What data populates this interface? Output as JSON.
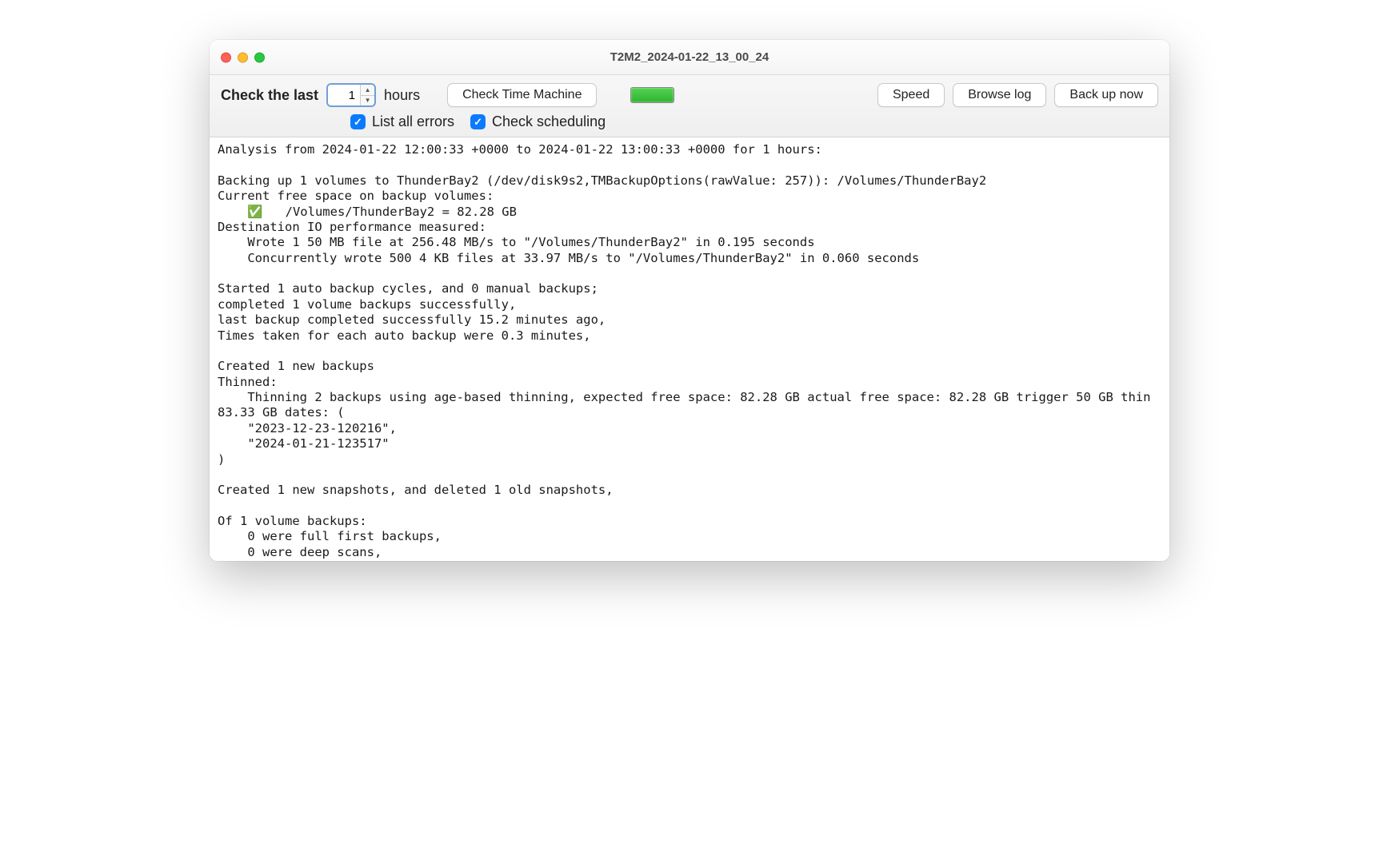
{
  "window": {
    "title": "T2M2_2024-01-22_13_00_24"
  },
  "toolbar": {
    "check_last_label": "Check the last",
    "hours_value": "1",
    "hours_unit": "hours",
    "check_tm_label": "Check Time Machine",
    "speed_label": "Speed",
    "browse_log_label": "Browse log",
    "backup_now_label": "Back up now",
    "list_errors_label": "List all errors",
    "list_errors_checked": true,
    "check_scheduling_label": "Check scheduling",
    "check_scheduling_checked": true,
    "status_color": "#2fb42f"
  },
  "log": {
    "text": "Analysis from 2024-01-22 12:00:33 +0000 to 2024-01-22 13:00:33 +0000 for 1 hours:\n\nBacking up 1 volumes to ThunderBay2 (/dev/disk9s2,TMBackupOptions(rawValue: 257)): /Volumes/ThunderBay2\nCurrent free space on backup volumes:\n    ✅   /Volumes/ThunderBay2 = 82.28 GB\nDestination IO performance measured:\n    Wrote 1 50 MB file at 256.48 MB/s to \"/Volumes/ThunderBay2\" in 0.195 seconds\n    Concurrently wrote 500 4 KB files at 33.97 MB/s to \"/Volumes/ThunderBay2\" in 0.060 seconds\n\nStarted 1 auto backup cycles, and 0 manual backups;\ncompleted 1 volume backups successfully,\nlast backup completed successfully 15.2 minutes ago,\nTimes taken for each auto backup were 0.3 minutes,\n\nCreated 1 new backups\nThinned:\n    Thinning 2 backups using age-based thinning, expected free space: 82.28 GB actual free space: 82.28 GB trigger 50 GB thin 83.33 GB dates: (\n    \"2023-12-23-120216\",\n    \"2024-01-21-123517\"\n)\n\nCreated 1 new snapshots, and deleted 1 old snapshots,\n\nOf 1 volume backups:\n    0 were full first backups,\n    0 were deep scans,"
  }
}
